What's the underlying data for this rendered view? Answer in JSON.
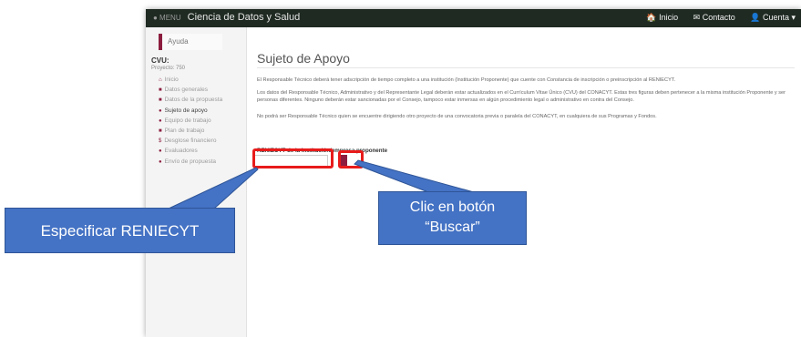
{
  "navbar": {
    "logo_text": "● MENU",
    "title": "Ciencia de Datos y Salud",
    "links": [
      "🏠 Inicio",
      "✉ Contacto",
      "👤 Cuenta ▾"
    ]
  },
  "sidebar": {
    "help_label": "Ayuda",
    "cvu_label": "CVU:",
    "project_label": "Proyecto: 750",
    "items": [
      {
        "icon": "home-icon",
        "label": "Inicio",
        "active": false
      },
      {
        "icon": "document-icon",
        "label": "Datos generales",
        "active": false
      },
      {
        "icon": "document-icon",
        "label": "Datos de la propuesta",
        "active": false
      },
      {
        "icon": "user-icon",
        "label": "Sujeto de apoyo",
        "active": true
      },
      {
        "icon": "group-icon",
        "label": "Equipo de trabajo",
        "active": false
      },
      {
        "icon": "calendar-icon",
        "label": "Plan de trabajo",
        "active": false
      },
      {
        "icon": "money-icon",
        "label": "Desglose financiero",
        "active": false
      },
      {
        "icon": "evaluators-icon",
        "label": "Evaluadores",
        "active": false
      },
      {
        "icon": "send-icon",
        "label": "Envío de propuesta",
        "active": false
      }
    ]
  },
  "main": {
    "title": "Sujeto de Apoyo",
    "paragraphs": [
      "El Responsable Técnico deberá tener adscripción de tiempo completo a una institución (Institución Proponente) que cuente con Constancia de inscripción o preinscripción al RENIECYT.",
      "Los datos del Responsable Técnico, Administrativo y del Representante Legal deberán estar actualizados en el Currículum Vitae Único (CVU) del CONACYT. Estas tres figuras deben pertenecer a la misma institución Proponente y ser personas diferentes. Ninguno deberán estar sancionadas por el Consejo, tampoco estar inmersas en algún procedimiento legal o administrativo en contra del Consejo.",
      "No podrá ser Responsable Técnico quien se encuentre dirigiendo otro proyecto de una convocatoria previa o paralela del CONACYT, en cualquiera de sus Programas y Fondos."
    ],
    "reniecyt_label": "RENIECYT de la institución/empresa proponente",
    "reniecyt_value": ""
  },
  "annotations": {
    "left_callout": "Especificar RENIECYT",
    "right_callout_line1": "Clic en botón",
    "right_callout_line2": "“Buscar”",
    "callout_color": "#4472c4",
    "highlight_color": "#e81b1b"
  },
  "colors": {
    "brand": "#8c1d3f",
    "navbar": "#1f2a22"
  }
}
